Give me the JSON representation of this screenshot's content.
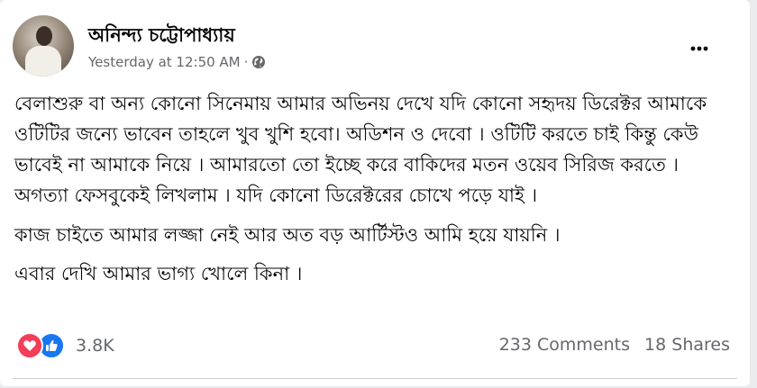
{
  "post": {
    "author": "অনিন্দ্য চট্টোপাধ্যায়",
    "timestamp": "Yesterday at 12:50 AM",
    "separator": "·",
    "privacy_icon": "globe-icon",
    "menu_icon": "more-options-icon",
    "paragraphs": [
      "বেলাশুরু বা অন্য কোনো সিনেমায় আমার অভিনয় দেখে যদি কোনো  সহৃদয় ডিরেক্টর আমাকে ওটিটির জন্যে ভাবেন তাহলে খুব খুশি হবো। অডিশন ও দেবো । ওটিটি করতে চাই কিন্তু কেউ ভাবেই না আমাকে নিয়ে । আমারতো তো ইচ্ছে করে বাকিদের মতন ওয়েব সিরিজ করতে । অগত্যা ফেসবুকেই লিখলাম । যদি কোনো ডিরেক্টরের চোখে পড়ে যাই ।",
      "কাজ চাইতে আমার লজ্জা নেই আর অত বড় আর্টিস্টও  আমি হয়ে যায়নি ।",
      "এবার দেখি আমার ভাগ্য খোলে কিনা ।"
    ]
  },
  "engagement": {
    "reaction_icons": [
      "love-icon",
      "like-icon"
    ],
    "reaction_count": "3.8K",
    "comments": "233 Comments",
    "shares": "18 Shares"
  },
  "colors": {
    "love": "#f33e58",
    "like": "#1877f2",
    "secondary_text": "#65676b"
  }
}
